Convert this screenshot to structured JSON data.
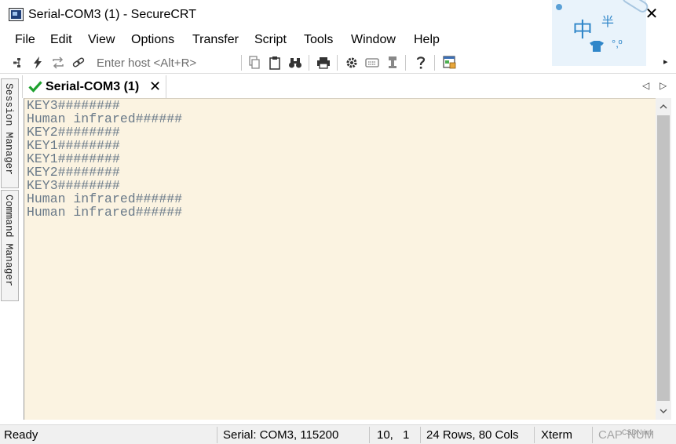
{
  "window": {
    "title": "Serial-COM3 (1) - SecureCRT",
    "close_glyph": "✕"
  },
  "ime": {
    "mode_char": "中",
    "width_char": "半",
    "punct": "°,º"
  },
  "menu": {
    "items": [
      "File",
      "Edit",
      "View",
      "Options",
      "Transfer",
      "Script",
      "Tools",
      "Window",
      "Help"
    ]
  },
  "toolbar": {
    "host_placeholder": "Enter host <Alt+R>",
    "icons": [
      "connect-tree-icon",
      "lightning-icon",
      "reconnect-icon",
      "link-icon",
      "copy-icon",
      "paste-icon",
      "find-icon",
      "print-icon",
      "settings-icon",
      "keymap-icon",
      "stamp-icon",
      "help-icon",
      "sftp-icon"
    ],
    "more_glyph": "▸"
  },
  "dock": {
    "session_manager": "Session Manager",
    "command_manager": "Command Manager"
  },
  "tabs": {
    "active_label": "Serial-COM3 (1)",
    "close_glyph": "✕",
    "nav_left": "◁",
    "nav_right": "▷"
  },
  "terminal": {
    "lines": [
      "KEY3########",
      "Human infrared######",
      "KEY2########",
      "KEY1########",
      "KEY1########",
      "KEY2########",
      "KEY3########",
      "Human infrared######",
      "Human infrared######"
    ]
  },
  "status": {
    "ready": "Ready",
    "serial": "Serial: COM3, 115200",
    "cursor_row": "10,",
    "cursor_col": "1",
    "dimensions": "24 Rows, 80 Cols",
    "emulation": "Xterm",
    "caps": "CAP",
    "num": "NUM",
    "mini": "CSDN inf."
  },
  "colors": {
    "terminal_bg": "#fbf3e1",
    "terminal_text": "#6a7a89",
    "active_check": "#1fa12f"
  }
}
